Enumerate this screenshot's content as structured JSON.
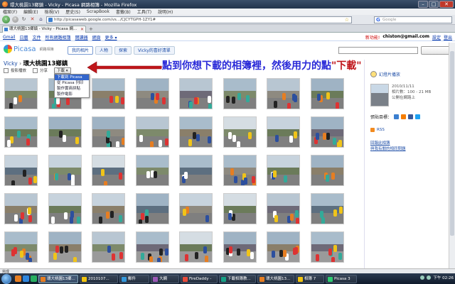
{
  "window": {
    "title": "環大桃園13鄉鎮 - Vicky - Picasa 網路相簿 - Mozilla Firefox"
  },
  "menu": [
    "檔案(F)",
    "編輯(E)",
    "檢視(V)",
    "歷史(S)",
    "ScrapBook",
    "書籤(B)",
    "工具(T)",
    "說明(H)"
  ],
  "nav": {
    "url": "http://picasaweb.google.com/vs.../CJCYTGPH-1ZY1#",
    "search_placeholder": "Google"
  },
  "tab": {
    "label": "環大桃園13鄉鎮 - Vicky - Picasa 網..."
  },
  "gbar": {
    "links": [
      "Gmail",
      "日曆",
      "文件",
      "所有網路相簿",
      "閱讀器",
      "網頁",
      "更多 ▾"
    ],
    "new_label": "新功能!",
    "email": "chiston@gmail.com",
    "settings": "設定",
    "signout": "登出"
  },
  "picasa": {
    "logo": "Picasa",
    "logo_sub": "網路相簿",
    "tabs": [
      "我的相片",
      "人物",
      "探索",
      "Vicky的喜好清單"
    ]
  },
  "album": {
    "owner": "Vicky",
    "separator": " › ",
    "title": "環大桃園13鄉鎮",
    "toolbar": {
      "slideshow": "投影播放",
      "share": "分享",
      "download": "下載 ▾"
    },
    "download_menu": [
      "下載到 Picasa",
      "從 Picasa 列印",
      "製作實商拼貼",
      "製作電影"
    ]
  },
  "annotation": {
    "main": "點到你想下載的相簿裡，然後用力的點",
    "highlight": "\"下載\""
  },
  "sidebar": {
    "slideshow_link": "幻燈片播放",
    "date": "2010/11/11",
    "count": "相片數：100 - 21 MB",
    "visibility": "公開在網路上",
    "share_label": "張貼目標：",
    "rss": "RSS",
    "links": [
      "回報此相簿",
      "與我有關的相同問題"
    ]
  },
  "statusbar": {
    "text": "完成"
  },
  "taskbar": {
    "tasks": [
      "環大桃園13鄉...",
      "2010107... ",
      "郵件",
      "大網",
      "FireDaddy -",
      "下載相簿教...",
      "環大桃園13...",
      "相簿 7",
      "Picasa 3"
    ],
    "time": "下午 02:26"
  }
}
